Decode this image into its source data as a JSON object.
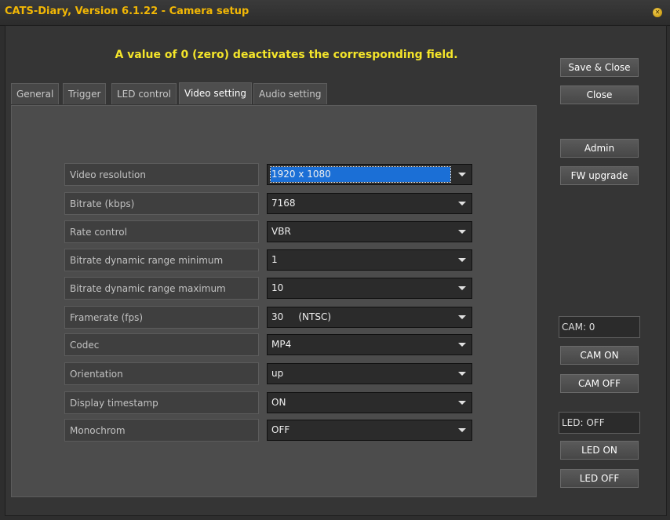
{
  "window": {
    "title": "CATS-Diary, Version 6.1.22 - Camera setup",
    "accent_color": "#f2b705"
  },
  "notice": "A value of 0 (zero) deactivates the corresponding field.",
  "tabs": [
    {
      "label": "General",
      "active": false
    },
    {
      "label": "Trigger",
      "active": false
    },
    {
      "label": "LED control",
      "active": false
    },
    {
      "label": "Video setting",
      "active": true
    },
    {
      "label": "Audio setting",
      "active": false
    }
  ],
  "settings": [
    {
      "label": "Video resolution",
      "value": "1920 x 1080",
      "focused": true
    },
    {
      "label": "Bitrate (kbps)",
      "value": "7168"
    },
    {
      "label": "Rate control",
      "value": "VBR"
    },
    {
      "label": "Bitrate dynamic range minimum",
      "value": "1"
    },
    {
      "label": "Bitrate dynamic range maximum",
      "value": "10"
    },
    {
      "label": "Framerate (fps)",
      "value": "30     (NTSC)"
    },
    {
      "label": "Codec",
      "value": "MP4"
    },
    {
      "label": "Orientation",
      "value": "up"
    },
    {
      "label": "Display timestamp",
      "value": "ON"
    },
    {
      "label": "Monochrom",
      "value": "OFF"
    }
  ],
  "side_buttons": {
    "save_close": "Save & Close",
    "close": "Close",
    "admin": "Admin",
    "fw_upgrade": "FW upgrade",
    "cam_on": "CAM ON",
    "cam_off": "CAM OFF",
    "led_on": "LED ON",
    "led_off": "LED OFF"
  },
  "status": {
    "cam": "CAM: 0",
    "led": "LED: OFF"
  }
}
